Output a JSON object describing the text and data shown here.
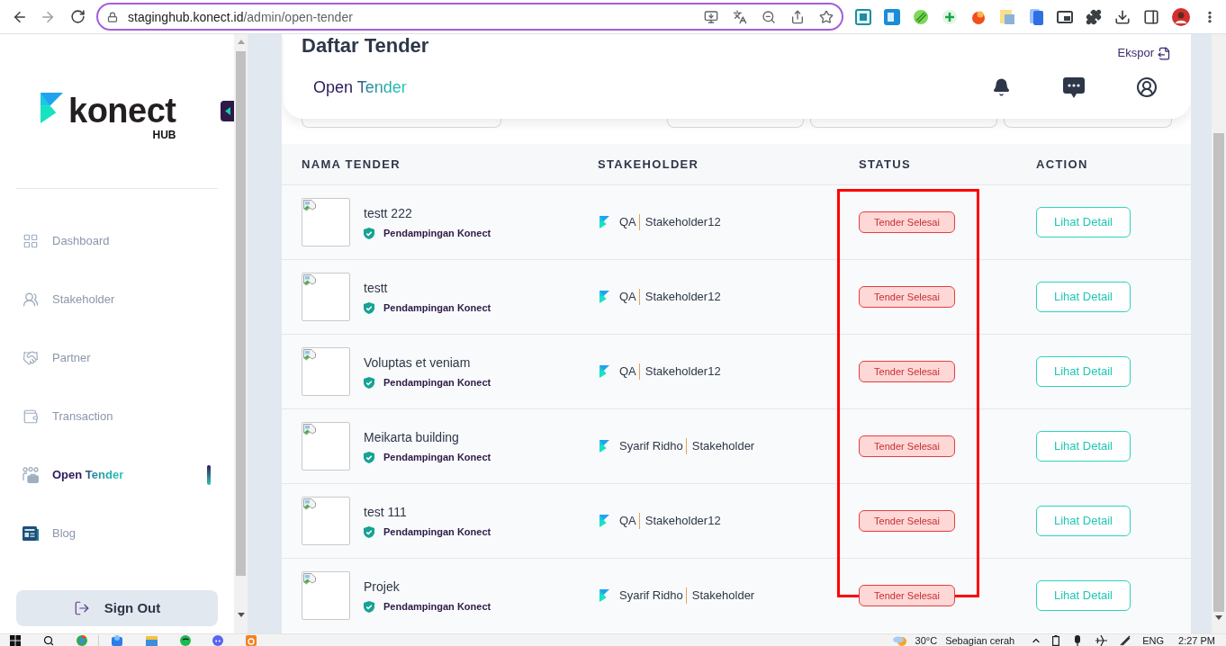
{
  "browser": {
    "url_host": "staginghub.konect.id",
    "url_path": "/admin/open-tender"
  },
  "sidebar": {
    "logo": {
      "name": "konect",
      "tag": "HUB"
    },
    "items": [
      {
        "label": "Dashboard",
        "selected": false
      },
      {
        "label": "Stakeholder",
        "selected": false
      },
      {
        "label": "Partner",
        "selected": false
      },
      {
        "label": "Transaction",
        "selected": false
      },
      {
        "label": "Open Tender",
        "selected": true
      },
      {
        "label": "Blog",
        "selected": false
      }
    ],
    "sign_out": "Sign Out"
  },
  "header": {
    "page_title": "Daftar Tender",
    "export": "Ekspor",
    "title": "Open Tender"
  },
  "table": {
    "columns": [
      "NAMA TENDER",
      "STAKEHOLDER",
      "STATUS",
      "ACTION"
    ],
    "rows": [
      {
        "name": "testt 222",
        "badge": "Pendampingan Konect",
        "stakeholder": "QA",
        "role": "Stakeholder12",
        "status": "Tender Selesai",
        "action": "Lihat Detail"
      },
      {
        "name": "testt",
        "badge": "Pendampingan Konect",
        "stakeholder": "QA",
        "role": "Stakeholder12",
        "status": "Tender Selesai",
        "action": "Lihat Detail"
      },
      {
        "name": "Voluptas et veniam",
        "badge": "Pendampingan Konect",
        "stakeholder": "QA",
        "role": "Stakeholder12",
        "status": "Tender Selesai",
        "action": "Lihat Detail"
      },
      {
        "name": "Meikarta building",
        "badge": "Pendampingan Konect",
        "stakeholder": "Syarif Ridho",
        "role": "Stakeholder",
        "status": "Tender Selesai",
        "action": "Lihat Detail"
      },
      {
        "name": "test 111",
        "badge": "Pendampingan Konect",
        "stakeholder": "QA",
        "role": "Stakeholder12",
        "status": "Tender Selesai",
        "action": "Lihat Detail"
      },
      {
        "name": "Projek",
        "badge": "Pendampingan Konect",
        "stakeholder": "Syarif Ridho",
        "role": "Stakeholder",
        "status": "Tender Selesai",
        "action": "Lihat Detail"
      }
    ]
  },
  "taskbar": {
    "temperature": "30°C",
    "weather": "Sebagian cerah",
    "language": "ENG",
    "time": "2:27 PM"
  }
}
